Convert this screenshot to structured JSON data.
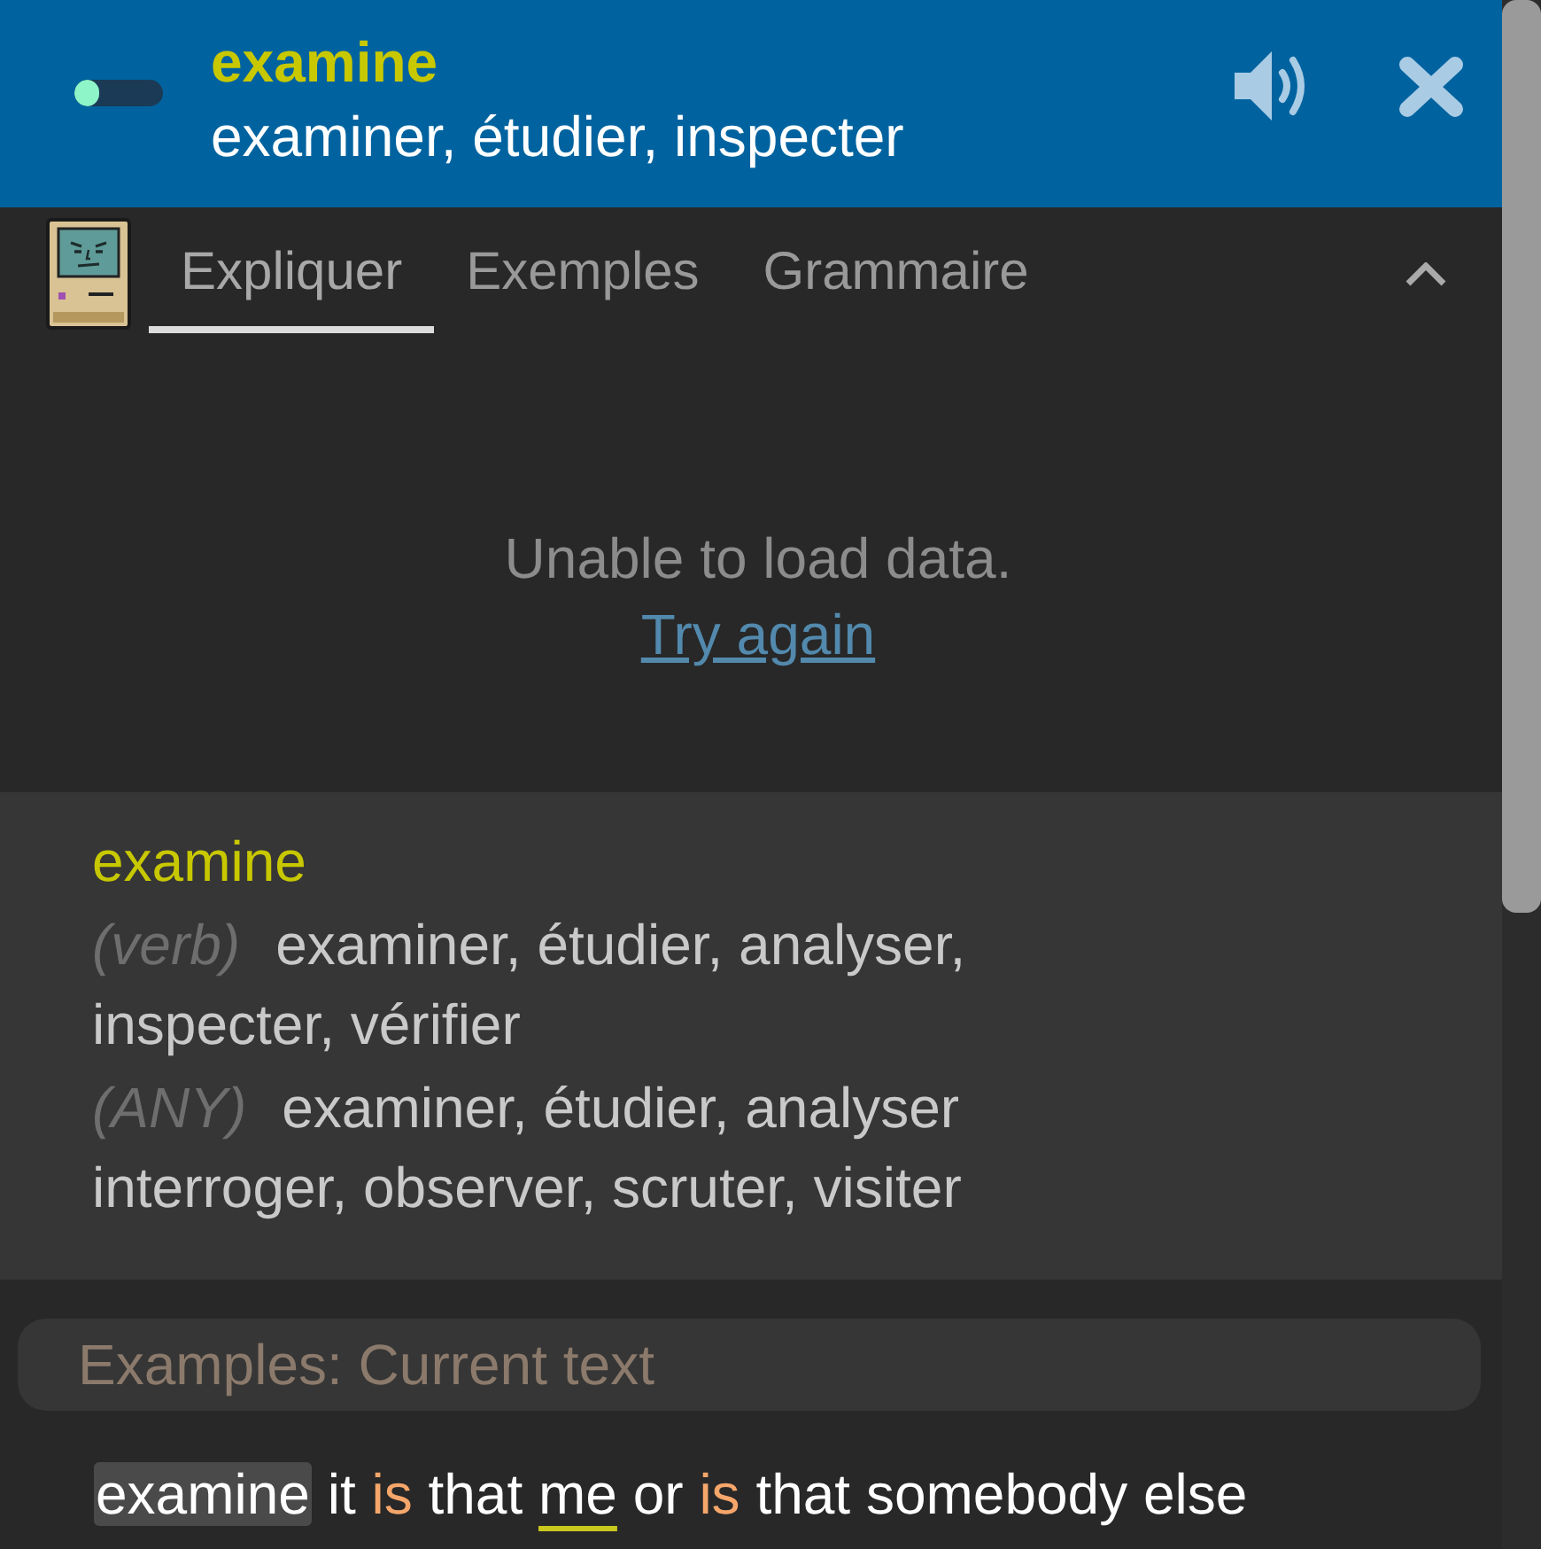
{
  "header": {
    "progress": {
      "level": 0.28
    },
    "word": "examine",
    "translation": "examiner, étudier, inspecter"
  },
  "tabs": [
    {
      "label": "Expliquer",
      "selected": true
    },
    {
      "label": "Exemples",
      "selected": false
    },
    {
      "label": "Grammaire",
      "selected": false
    }
  ],
  "panel": {
    "expanded": true
  },
  "explain": {
    "message": "Unable to load data.",
    "retry_link": "Try again"
  },
  "definition": {
    "word": "examine",
    "senses": [
      {
        "pos": "(verb)",
        "meanings": "examiner, étudier, analyser, inspecter, vérifier"
      },
      {
        "pos": "(ANY)",
        "meanings": "examiner, étudier, analyser interroger, observer, scruter, visiter"
      }
    ]
  },
  "examples": {
    "heading": "Examples: Current text",
    "sentence": [
      {
        "text": "examine",
        "kind": "current"
      },
      {
        "text": "it",
        "kind": "plain"
      },
      {
        "text": "is",
        "kind": "accent"
      },
      {
        "text": "that",
        "kind": "plain"
      },
      {
        "text": "me",
        "kind": "underlined"
      },
      {
        "text": "or",
        "kind": "plain"
      },
      {
        "text": "is",
        "kind": "accent"
      },
      {
        "text": "that somebody else",
        "kind": "plain"
      }
    ]
  }
}
